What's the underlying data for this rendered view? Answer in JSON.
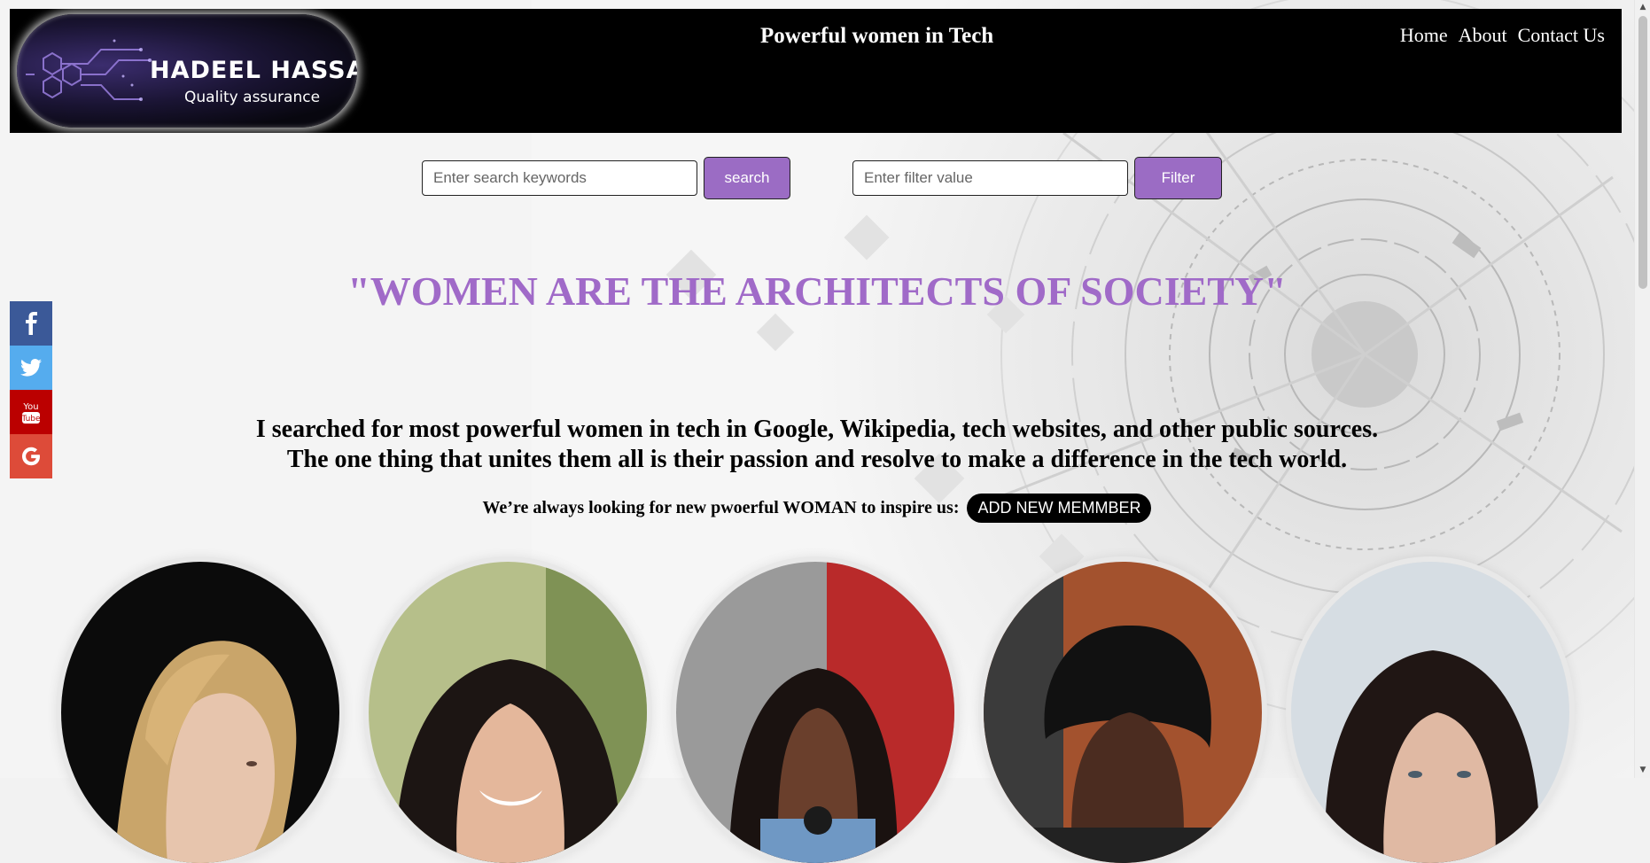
{
  "header": {
    "logo": {
      "name": "HADEEL HASSAN",
      "subtitle": "Quality assurance"
    },
    "title": "Powerful women in Tech",
    "nav": [
      "Home",
      "About",
      "Contact Us"
    ]
  },
  "search": {
    "placeholder": "Enter search keywords",
    "button": "search"
  },
  "filter": {
    "placeholder": "Enter filter value",
    "button": "Filter"
  },
  "quote": "\"WOMEN ARE THE ARCHITECTS OF SOCIETY\"",
  "intro": [
    "I searched for most powerful women in tech in Google, Wikipedia, tech websites, and other public sources.",
    "The one thing that unites them all is their passion and resolve to make a difference in the tech world."
  ],
  "cta": {
    "text": "We’re always looking for new pwoerful WOMAN to inspire us:",
    "button": "ADD NEW MEMMBER"
  },
  "social": [
    {
      "name": "facebook",
      "icon": "facebook-icon",
      "color": "#3b5998"
    },
    {
      "name": "twitter",
      "icon": "twitter-icon",
      "color": "#55acee"
    },
    {
      "name": "youtube",
      "icon": "youtube-icon",
      "color": "#bb0000"
    },
    {
      "name": "google",
      "icon": "google-icon",
      "color": "#dd4b39"
    }
  ],
  "colors": {
    "accent": "#9b6cc4",
    "quote": "#a06ac8",
    "header_bg": "#000000"
  },
  "cards": [
    {
      "portrait": "woman-blonde-hair-black-background"
    },
    {
      "portrait": "woman-dark-hair-smiling-green-background"
    },
    {
      "portrait": "woman-curly-hair-blue-dress-red-background"
    },
    {
      "portrait": "woman-curly-hair-black-jacket-speaking"
    },
    {
      "portrait": "woman-dark-hair-light-background"
    }
  ]
}
